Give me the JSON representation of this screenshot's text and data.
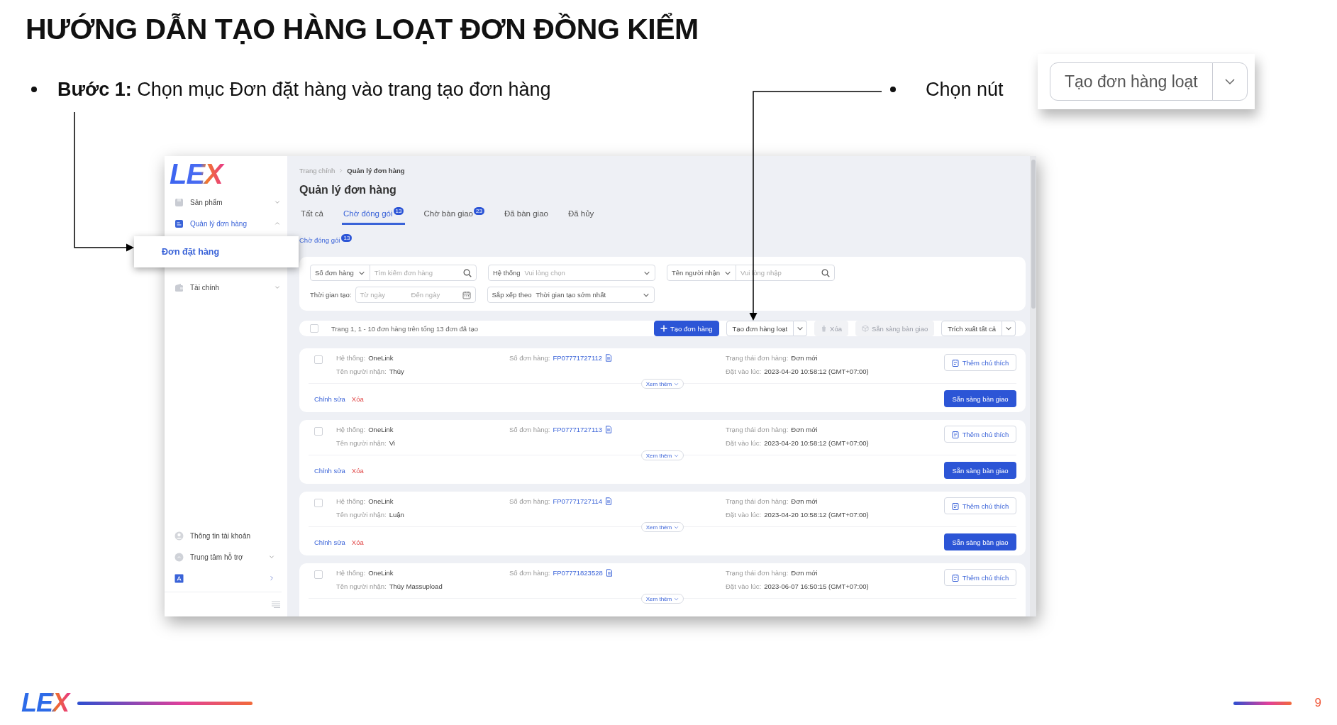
{
  "slide": {
    "title": "HƯỚNG DẪN TẠO HÀNG LOẠT ĐƠN ĐỒNG KIỂM",
    "step": "**Bước 1:** Chọn mục Đơn đặt hàng vào trang tạo đơn hàng",
    "hint": "Chọn nút",
    "hint_button": "Tạo đơn hàng loạt",
    "footer_logo": "LEX",
    "page_number": "9"
  },
  "app": {
    "logo": "LEX",
    "sidebar": {
      "items": [
        {
          "label": "Sản phẩm",
          "selected": false,
          "expanded": false
        },
        {
          "label": "Quản lý đơn hàng",
          "selected": true,
          "expanded": true,
          "children": [
            {
              "label": "Đơn đặt hàng",
              "selected": true
            }
          ]
        },
        {
          "label": "Tài chính",
          "selected": false,
          "expanded": false
        }
      ],
      "bottom_items": [
        {
          "kind": "plain",
          "label": "Thông tin tài khoản"
        },
        {
          "kind": "expandable",
          "label": "Trung tâm hỗ trợ"
        },
        {
          "kind": "link"
        }
      ]
    },
    "breadcrumb": [
      "Trang chính",
      "Quản lý đơn hàng"
    ],
    "page_title": "Quản lý đơn hàng",
    "tabs": [
      {
        "label": "Tất cả",
        "selected": false
      },
      {
        "label": "Chờ đóng gói",
        "count": "13",
        "selected": true
      },
      {
        "label": "Chờ bàn giao",
        "count": "23",
        "selected": false
      },
      {
        "label": "Đã bàn giao",
        "selected": false
      },
      {
        "label": "Đã hủy",
        "selected": false
      }
    ],
    "sub_tab": {
      "label": "Chờ đóng gói",
      "count": "13"
    },
    "filters": {
      "order_select": "Số đơn hàng",
      "order_placeholder": "Tìm kiếm đơn hàng",
      "system_label": "Hệ thống",
      "system_placeholder": "Vui lòng chọn",
      "recipient_select": "Tên người nhận",
      "recipient_placeholder": "Vui lòng nhập",
      "date_label": "Thời gian tạo:",
      "date_from_placeholder": "Từ ngày",
      "date_to_placeholder": "Đến ngày",
      "sort_label": "Sắp xếp theo",
      "sort_value": "Thời gian tạo sớm nhất"
    },
    "toolbar": {
      "checked": false,
      "summary": "Trang 1, 1 - 10 đơn hàng trên tổng 13 đơn đã tạo",
      "buttons": [
        {
          "kind": "primary",
          "label": "Tạo đơn hàng",
          "disabled": false
        },
        {
          "kind": "split",
          "label": "Tạo đơn hàng loạt",
          "disabled": false
        },
        {
          "kind": "delete",
          "label": "Xóa",
          "disabled": true
        },
        {
          "kind": "handover",
          "label": "Sẵn sàng bàn giao",
          "disabled": true
        },
        {
          "kind": "split",
          "label": "Trích xuất tất cả",
          "disabled": false
        }
      ]
    },
    "orders": [
      {
        "checked": false,
        "system_label": "Hệ thống:",
        "system": "OneLink",
        "recipient_label": "Tên người nhận:",
        "recipient": "Thủy",
        "order_label": "Số đơn hàng:",
        "order_no": "FP07771727112",
        "status_label": "Trạng thái đơn hàng:",
        "status": "Đơn mới",
        "time_label": "Đặt vào lúc:",
        "time": "2023-04-20 10:58:12 (GMT+07:00)",
        "more": "Xem thêm",
        "note_button": "Thêm chú thích",
        "edit": "Chỉnh sửa",
        "delete": "Xóa",
        "action_button": "Sẵn sàng bàn giao"
      },
      {
        "checked": false,
        "system_label": "Hệ thống:",
        "system": "OneLink",
        "recipient_label": "Tên người nhận:",
        "recipient": "Vi",
        "order_label": "Số đơn hàng:",
        "order_no": "FP07771727113",
        "status_label": "Trạng thái đơn hàng:",
        "status": "Đơn mới",
        "time_label": "Đặt vào lúc:",
        "time": "2023-04-20 10:58:12 (GMT+07:00)",
        "more": "Xem thêm",
        "note_button": "Thêm chú thích",
        "edit": "Chỉnh sửa",
        "delete": "Xóa",
        "action_button": "Sẵn sàng bàn giao"
      },
      {
        "checked": false,
        "system_label": "Hệ thống:",
        "system": "OneLink",
        "recipient_label": "Tên người nhận:",
        "recipient": "Luận",
        "order_label": "Số đơn hàng:",
        "order_no": "FP07771727114",
        "status_label": "Trạng thái đơn hàng:",
        "status": "Đơn mới",
        "time_label": "Đặt vào lúc:",
        "time": "2023-04-20 10:58:12 (GMT+07:00)",
        "more": "Xem thêm",
        "note_button": "Thêm chú thích",
        "edit": "Chỉnh sửa",
        "delete": "Xóa",
        "action_button": "Sẵn sàng bàn giao"
      },
      {
        "checked": false,
        "system_label": "Hệ thống:",
        "system": "OneLink",
        "recipient_label": "Tên người nhận:",
        "recipient": "Thủy Massupload",
        "order_label": "Số đơn hàng:",
        "order_no": "FP07771823528",
        "status_label": "Trạng thái đơn hàng:",
        "status": "Đơn mới",
        "time_label": "Đặt vào lúc:",
        "time": "2023-06-07 16:50:15 (GMT+07:00)",
        "more": "Xem thêm",
        "note_button": "Thêm chú thích"
      }
    ]
  }
}
